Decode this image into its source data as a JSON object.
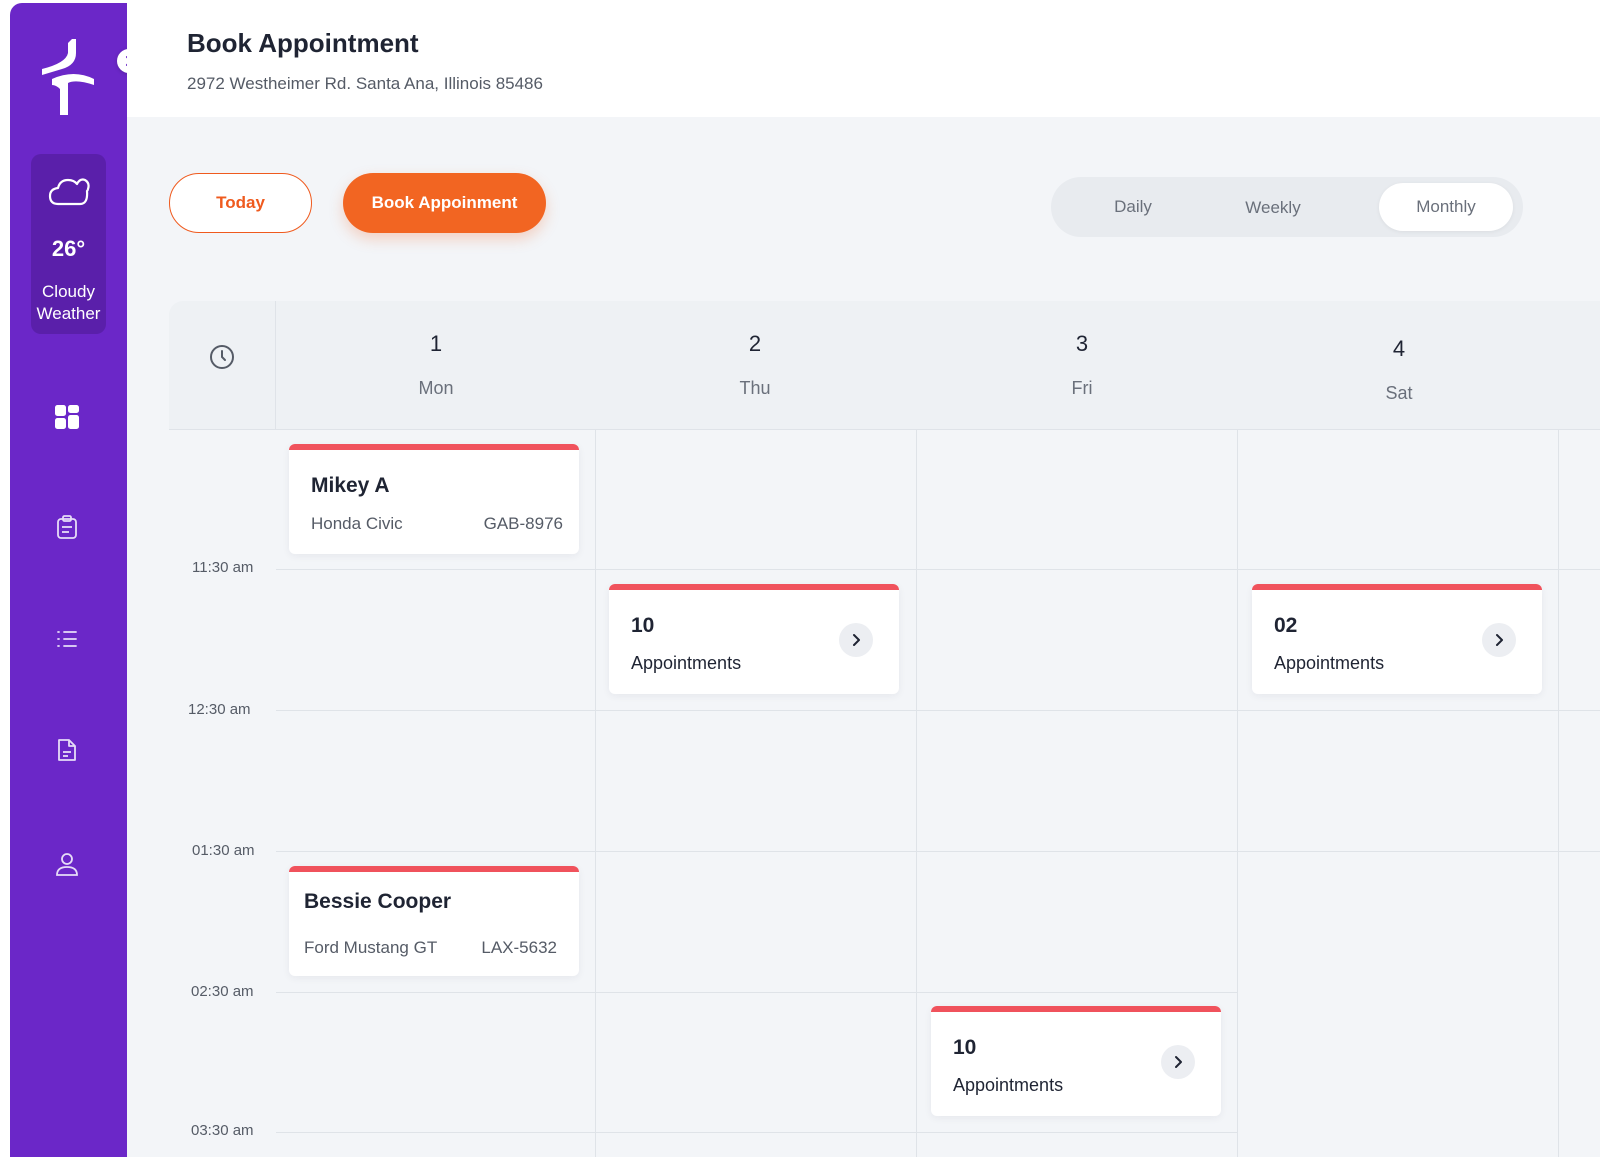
{
  "header": {
    "title": "Book Appointment",
    "address": "2972 Westheimer Rd. Santa Ana, Illinois 85486"
  },
  "sidebar": {
    "weather": {
      "temperature": "26°",
      "condition_line1": "Cloudy",
      "condition_line2": "Weather"
    },
    "nav_icons": [
      "dashboard-icon",
      "clipboard-icon",
      "list-icon",
      "document-icon",
      "user-icon"
    ]
  },
  "toolbar": {
    "today_label": "Today",
    "book_label": "Book Appoinment",
    "views": [
      "Daily",
      "Weekly",
      "Monthly"
    ],
    "active_view": "Monthly"
  },
  "calendar": {
    "days": [
      {
        "num": "1",
        "name": "Mon"
      },
      {
        "num": "2",
        "name": "Thu"
      },
      {
        "num": "3",
        "name": "Fri"
      },
      {
        "num": "4",
        "name": "Sat"
      }
    ],
    "times": [
      "11:30 am",
      "12:30 am",
      "01:30 am",
      "02:30 am",
      "03:30 am"
    ],
    "appointments": [
      {
        "name": "Mikey A",
        "car": "Honda Civic",
        "plate": "GAB-8976"
      },
      {
        "name": "Bessie Cooper",
        "car": "Ford Mustang GT",
        "plate": "LAX-5632"
      }
    ],
    "groups": [
      {
        "count": "10",
        "label": "Appointments"
      },
      {
        "count": "02",
        "label": "Appointments"
      },
      {
        "count": "10",
        "label": "Appointments"
      }
    ]
  },
  "colors": {
    "sidebar": "#6b27c8",
    "accent": "#f26522",
    "card_bar": "#f0525c"
  }
}
